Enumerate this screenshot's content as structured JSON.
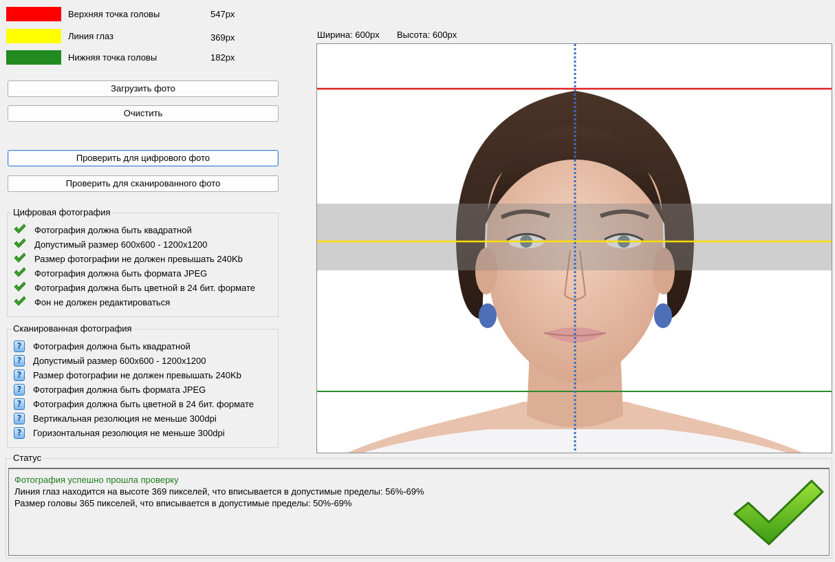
{
  "legend": [
    {
      "label": "Верхняя точка головы",
      "value": "547px",
      "color": "#ff0000"
    },
    {
      "label": "Линия глаз",
      "value": "369px",
      "color": "#ffff00"
    },
    {
      "label": "Нижняя точка головы",
      "value": "182px",
      "color": "#228b22"
    }
  ],
  "buttons": {
    "load": "Загрузить фото",
    "clear": "Очистить",
    "check_digital": "Проверить для цифрового фото",
    "check_scanned": "Проверить для сканированного фото"
  },
  "digital": {
    "title": "Цифровая фотография",
    "items": [
      "Фотография должна быть квадратной",
      "Допустимый размер 600x600 - 1200x1200",
      "Размер фотографии не должен превышать 240Kb",
      "Фотография должна быть формата JPEG",
      "Фотография должна быть цветной в 24 бит. формате",
      "Фон не должен редактироваться"
    ],
    "icon": "check-icon"
  },
  "scanned": {
    "title": "Сканированная фотография",
    "items": [
      "Фотография должна быть квадратной",
      "Допустимый размер 600x600 - 1200x1200",
      "Размер фотографии не должен превышать 240Kb",
      "Фотография должна быть формата JPEG",
      "Фотография должна быть цветной в 24 бит. формате",
      "Вертикальная резолюция не меньше 300dpi",
      "Горизонтальная резолюция не меньше 300dpi"
    ],
    "icon": "question-icon",
    "icon_glyph": "?"
  },
  "photo": {
    "width_label": "Ширина: 600px",
    "height_label": "Высота: 600px"
  },
  "status": {
    "title": "Статус",
    "success": "Фотография успешно прошла проверку",
    "line2": "Линия глаз находится на высоте 369 пикселей, что вписывается в допустимые пределы: 56%-69%",
    "line3": "Размер головы 365 пикселей, что вписывается в допустимые пределы: 50%-69%",
    "success_color": "#1e7d1e"
  }
}
